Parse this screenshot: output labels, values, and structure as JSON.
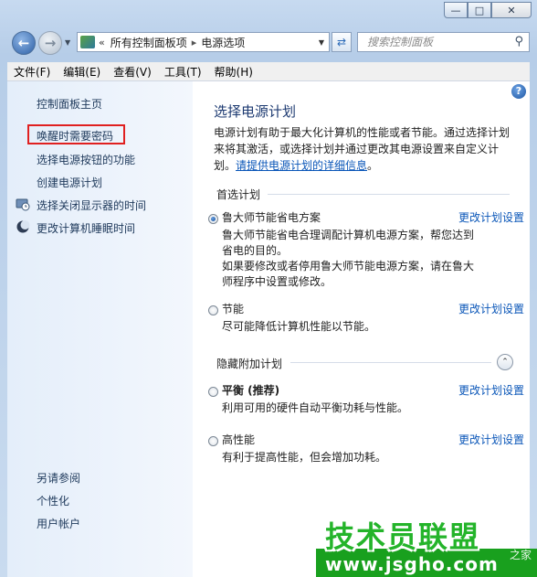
{
  "window": {
    "minimize_glyph": "—",
    "maximize_glyph": "□",
    "close_glyph": "✕"
  },
  "address": {
    "path_root": "所有控制面板项",
    "path_current": "电源选项",
    "search_placeholder": "搜索控制面板"
  },
  "menu": {
    "items": [
      "文件(F)",
      "编辑(E)",
      "查看(V)",
      "工具(T)",
      "帮助(H)"
    ]
  },
  "sidebar": {
    "items": [
      {
        "label": "控制面板主页"
      },
      {
        "label": "唤醒时需要密码",
        "highlighted": true
      },
      {
        "label": "选择电源按钮的功能"
      },
      {
        "label": "创建电源计划"
      },
      {
        "label": "选择关闭显示器的时间",
        "icon": "monitor-clock-icon"
      },
      {
        "label": "更改计算机睡眠时间",
        "icon": "moon-icon"
      }
    ],
    "see_also_title": "另请参阅",
    "see_also": [
      {
        "label": "个性化"
      },
      {
        "label": "用户帐户"
      }
    ]
  },
  "main": {
    "title": "选择电源计划",
    "intro_line1": "电源计划有助于最大化计算机的性能或者节能。通过选择计划",
    "intro_line2": "来将其激活，或选择计划并通过更改其电源设置来自定义计",
    "intro_line3_prefix": "划。",
    "intro_link": "请提供电源计划的详细信息",
    "intro_line3_suffix": "。",
    "preferred_title": "首选计划",
    "hidden_title": "隐藏附加计划",
    "change_link": "更改计划设置",
    "plans": [
      {
        "name": "鲁大师节能省电方案",
        "selected": true,
        "bold": false,
        "desc": [
          "鲁大师节能省电合理调配计算机电源方案，帮您达到",
          "省电的目的。",
          "如果要修改或者停用鲁大师节能电源方案，请在鲁大",
          "师程序中设置或修改。"
        ]
      },
      {
        "name": "节能",
        "selected": false,
        "bold": false,
        "desc": [
          "尽可能降低计算机性能以节能。"
        ]
      },
      {
        "name": "平衡 (推荐)",
        "selected": false,
        "bold": true,
        "desc": [
          "利用可用的硬件自动平衡功耗与性能。"
        ]
      },
      {
        "name": "高性能",
        "selected": false,
        "bold": false,
        "desc": [
          "有利于提高性能，但会增加功耗。"
        ]
      }
    ]
  },
  "watermark": {
    "title": "技术员联盟",
    "url": "www.jsgho.com",
    "suffix": "之家"
  },
  "colors": {
    "link": "#0a56b8",
    "title": "#1d3a71",
    "highlight_border": "#e02020",
    "watermark_green": "#24b42a"
  }
}
